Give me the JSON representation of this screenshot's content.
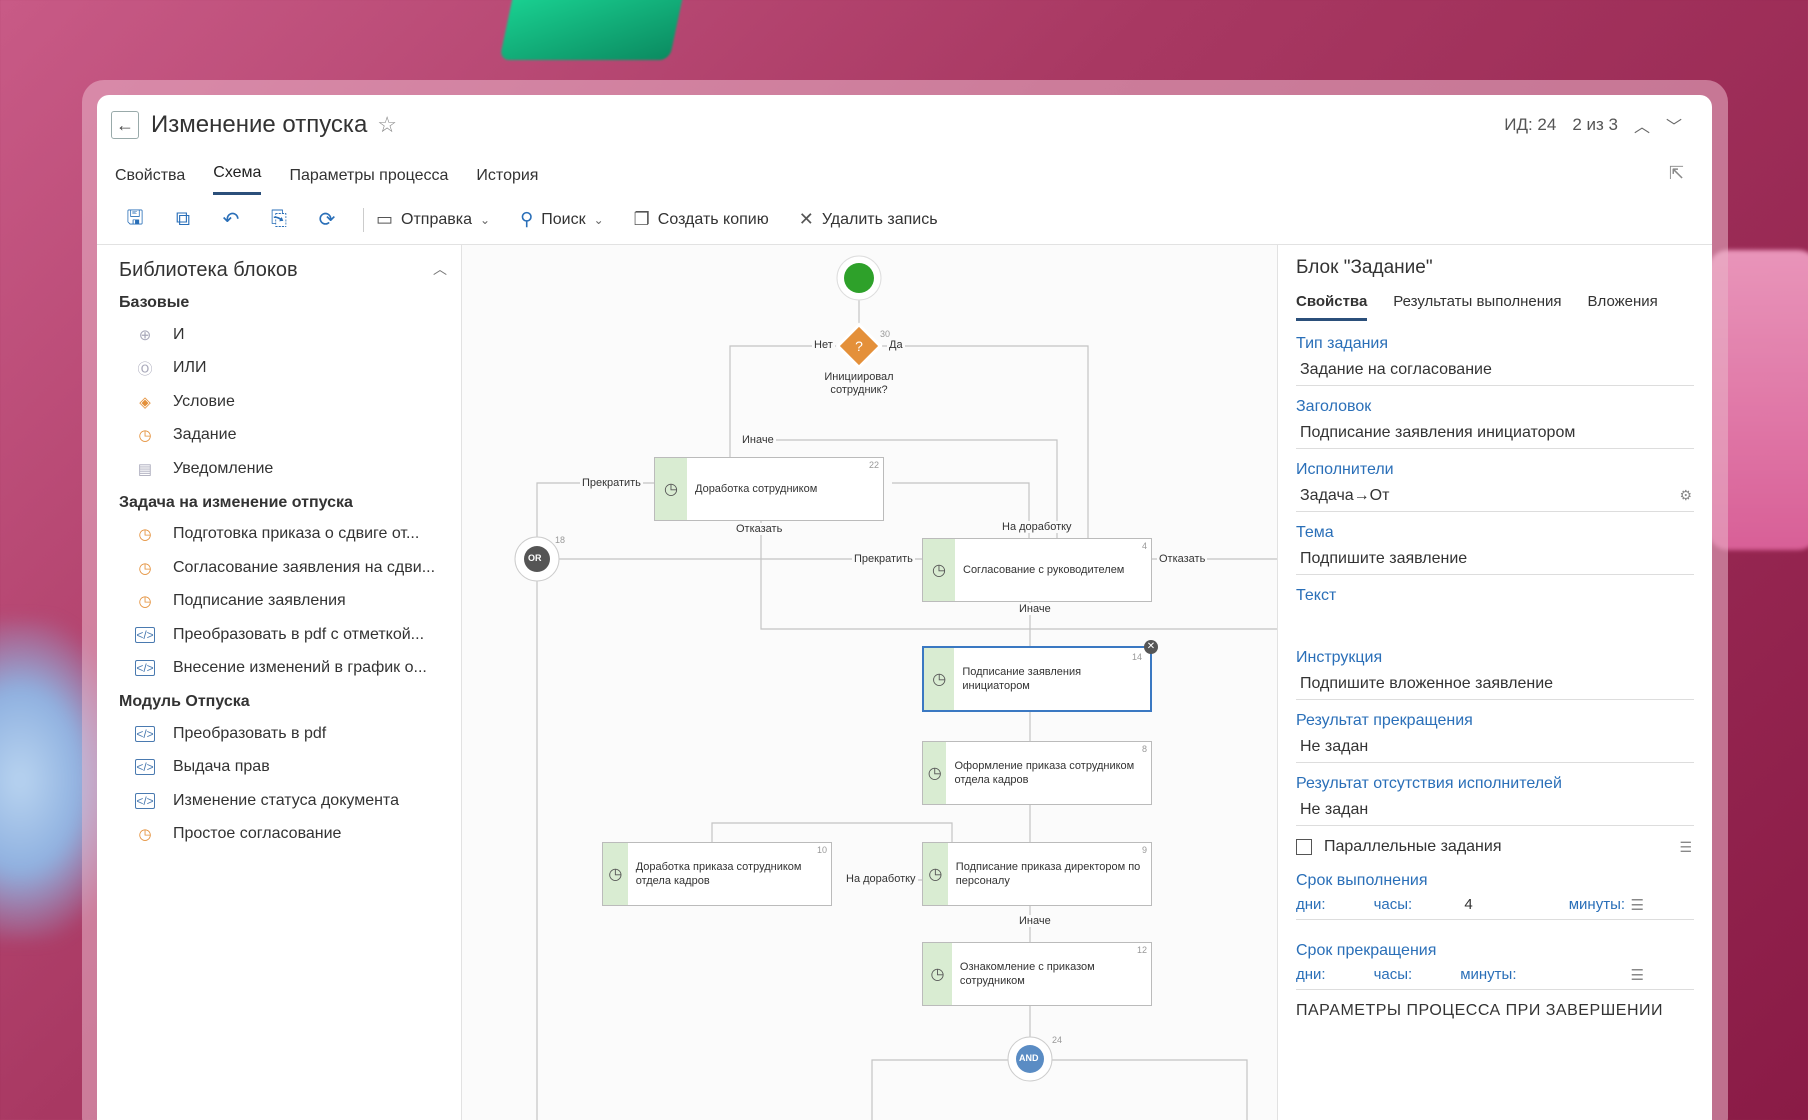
{
  "header": {
    "back_icon": "arrow-left-icon",
    "title": "Изменение отпуска",
    "id_text": "ИД: 24",
    "pager_text": "2 из 3"
  },
  "tabs": [
    "Свойства",
    "Схема",
    "Параметры процесса",
    "История"
  ],
  "active_tab": "Схема",
  "toolbar": {
    "send_label": "Отправка",
    "search_label": "Поиск",
    "copy_label": "Создать копию",
    "delete_label": "Удалить запись"
  },
  "library": {
    "title": "Библиотека блоков",
    "groups": [
      {
        "name": "Базовые",
        "items": [
          {
            "label": "И",
            "icon": "and-icon"
          },
          {
            "label": "ИЛИ",
            "icon": "or-icon"
          },
          {
            "label": "Условие",
            "icon": "condition-icon"
          },
          {
            "label": "Задание",
            "icon": "clock-icon"
          },
          {
            "label": "Уведомление",
            "icon": "notification-icon"
          }
        ]
      },
      {
        "name": "Задача на изменение отпуска",
        "items": [
          {
            "label": "Подготовка приказа о сдвиге от...",
            "icon": "clock-icon"
          },
          {
            "label": "Согласование заявления на сдви...",
            "icon": "clock-icon"
          },
          {
            "label": "Подписание заявления",
            "icon": "clock-icon"
          },
          {
            "label": "Преобразовать в pdf с отметкой...",
            "icon": "code-icon"
          },
          {
            "label": "Внесение изменений в график о...",
            "icon": "code-icon"
          }
        ]
      },
      {
        "name": "Модуль Отпуска",
        "items": [
          {
            "label": "Преобразовать в pdf",
            "icon": "code-icon"
          },
          {
            "label": "Выдача прав",
            "icon": "code-icon"
          },
          {
            "label": "Изменение статуса документа",
            "icon": "code-icon"
          },
          {
            "label": "Простое согласование",
            "icon": "clock-icon"
          }
        ]
      }
    ]
  },
  "diagram": {
    "condition_question": "Инициировал сотрудник?",
    "condition_no": "Нет",
    "condition_yes": "Да",
    "or_label": "OR",
    "and_label": "AND",
    "nodes": [
      {
        "id": "22",
        "text": "Доработка сотрудником"
      },
      {
        "id": "4",
        "text": "Согласование с руководителем"
      },
      {
        "id": "14",
        "text": "Подписание заявления инициатором"
      },
      {
        "id": "8",
        "text": "Оформление приказа сотрудником отдела кадров"
      },
      {
        "id": "10",
        "text": "Доработка приказа сотрудником отдела кадров"
      },
      {
        "id": "9",
        "text": "Подписание приказа директором по персоналу"
      },
      {
        "id": "12",
        "text": "Ознакомление с приказом сотрудником"
      }
    ],
    "small_numbers": {
      "cond": "30",
      "or": "18",
      "and": "24"
    },
    "edge_labels": {
      "otherwise1": "Иначе",
      "stop1": "Прекратить",
      "refuse1": "Отказать",
      "rework1": "На доработку",
      "stop2": "Прекратить",
      "refuse2": "Отказать",
      "otherwise2": "Иначе",
      "rework2": "На доработку",
      "otherwise3": "Иначе"
    }
  },
  "props": {
    "title": "Блок \"Задание\"",
    "tabs": [
      "Свойства",
      "Результаты выполнения",
      "Вложения"
    ],
    "fields": [
      {
        "label": "Тип задания",
        "value": "Задание на согласование"
      },
      {
        "label": "Заголовок",
        "value": "Подписание заявления инициатором"
      },
      {
        "label": "Исполнители",
        "value": "Задача→От"
      },
      {
        "label": "Тема",
        "value": "Подпишите заявление"
      },
      {
        "label": "Текст",
        "value": ""
      },
      {
        "label": "Инструкция",
        "value": "Подпишите вложенное заявление"
      },
      {
        "label": "Результат прекращения",
        "value": "Не задан"
      },
      {
        "label": "Результат отсутствия исполнителей",
        "value": "Не задан"
      }
    ],
    "parallel_label": "Параллельные задания",
    "deadline_label": "Срок выполнения",
    "deadline": {
      "days": "дни:",
      "hours": "часы:",
      "hours_val": "4",
      "minutes": "минуты:"
    },
    "stop_deadline_label": "Срок прекращения",
    "stop_deadline": {
      "days": "дни:",
      "hours": "часы:",
      "minutes": "минуты:"
    },
    "section_title": "ПАРАМЕТРЫ ПРОЦЕССА ПРИ ЗАВЕРШЕНИИ"
  },
  "colors": {
    "accent": "#2a6fb8",
    "start": "#2ea12a",
    "condition": "#e4903a",
    "task_strip": "#d9ecd2"
  }
}
